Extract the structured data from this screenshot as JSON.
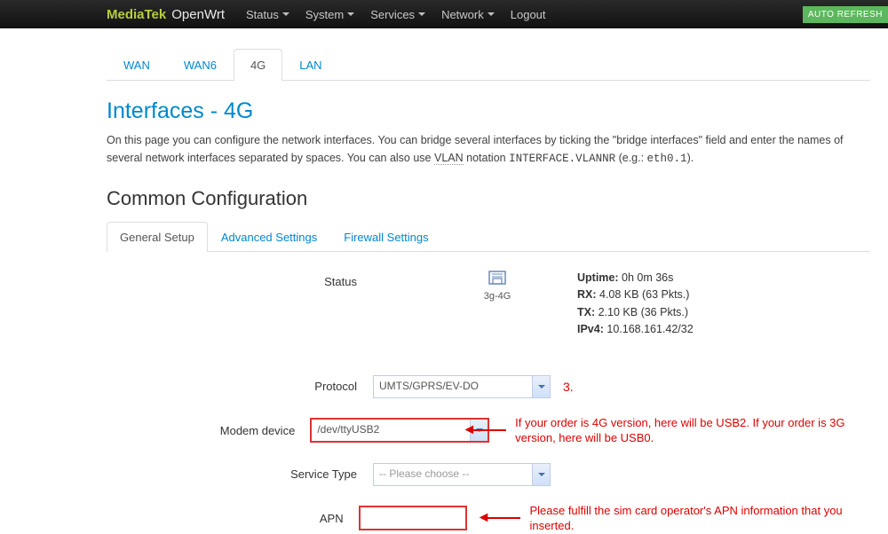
{
  "navbar": {
    "brand1": "MediaTek",
    "brand2": "OpenWrt",
    "items": [
      "Status",
      "System",
      "Services",
      "Network",
      "Logout"
    ],
    "auto_refresh": "AUTO REFRESH"
  },
  "iface_tabs": {
    "items": [
      "WAN",
      "WAN6",
      "4G",
      "LAN"
    ],
    "active": "4G"
  },
  "page": {
    "title": "Interfaces - 4G",
    "desc_pre": "On this page you can configure the network interfaces. You can bridge several interfaces by ticking the \"bridge interfaces\" field and enter the names of several network interfaces separated by spaces. You can also use ",
    "vlan_abbr": "VLAN",
    "desc_mid": " notation ",
    "vlan_code": "INTERFACE.VLANNR",
    "desc_eg": " (e.g.: ",
    "eg_code": "eth0.1",
    "desc_end": ")."
  },
  "section_title": "Common Configuration",
  "cfg_tabs": {
    "items": [
      "General Setup",
      "Advanced Settings",
      "Firewall Settings"
    ],
    "active": "General Setup"
  },
  "status": {
    "label": "Status",
    "iface_name": "3g-4G",
    "uptime_lbl": "Uptime:",
    "uptime_val": " 0h 0m 36s",
    "rx_lbl": "RX:",
    "rx_val": " 4.08 KB (63 Pkts.)",
    "tx_lbl": "TX:",
    "tx_val": " 2.10 KB (36 Pkts.)",
    "ipv4_lbl": "IPv4:",
    "ipv4_val": " 10.168.161.42/32"
  },
  "fields": {
    "protocol_lbl": "Protocol",
    "protocol_val": "UMTS/GPRS/EV-DO",
    "modem_lbl": "Modem device",
    "modem_val": "/dev/ttyUSB2",
    "service_lbl": "Service Type",
    "service_val": "-- Please choose --",
    "apn_lbl": "APN",
    "apn_val": ""
  },
  "annotations": {
    "num3": "3.",
    "modem_note": "If your order is 4G version, here will be USB2. If your order is 3G version, here will be USB0.",
    "apn_note": "Please fulfill the sim card operator's APN information that you inserted."
  }
}
